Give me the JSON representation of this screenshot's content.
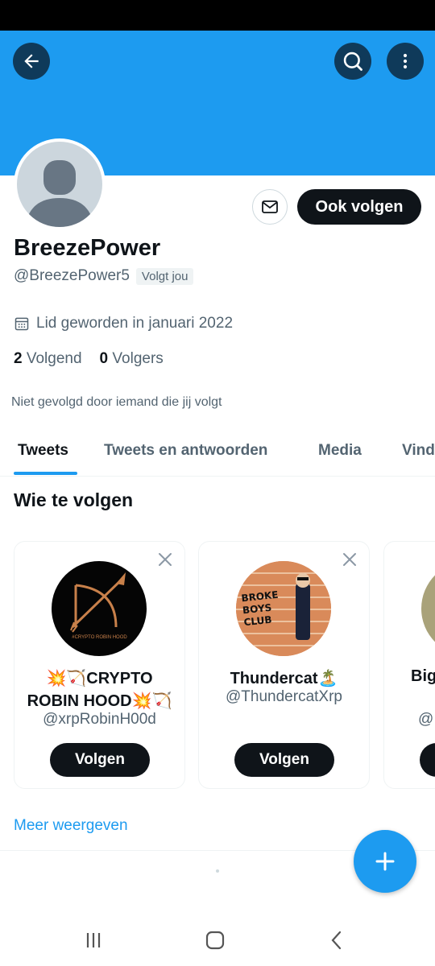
{
  "colors": {
    "accent": "#1d9bf0",
    "text_primary": "#0f1419",
    "text_secondary": "#536471",
    "border": "#eff3f4"
  },
  "header": {
    "back_icon": "arrow-left-icon",
    "search_icon": "search-icon",
    "more_icon": "more-vertical-icon"
  },
  "profile": {
    "display_name": "BreezePower",
    "handle": "@BreezePower5",
    "follows_you": "Volgt jou",
    "joined": "Lid geworden in januari 2022",
    "following_count": "2",
    "following_label": "Volgend",
    "followers_count": "0",
    "followers_label": "Volgers",
    "not_followed_text": "Niet gevolgd door iemand die jij volgt",
    "follow_back_label": "Ook volgen",
    "message_icon": "mail-icon"
  },
  "tabs": [
    {
      "label": "Tweets",
      "active": true
    },
    {
      "label": "Tweets en antwoorden",
      "active": false
    },
    {
      "label": "Media",
      "active": false
    },
    {
      "label": "Vind",
      "active": false
    }
  ],
  "who_to_follow": {
    "title": "Wie te volgen",
    "cards": [
      {
        "name": "💥🏹CRYPTO ROBIN HOOD💥🏹",
        "handle": "@xrpRobinH00d",
        "button": "Volgen",
        "avatar_text": "#CRYPTO ROBIN HOOD"
      },
      {
        "name": "Thundercat🏝️",
        "handle": "@ThundercatXrp",
        "button": "Volgen",
        "avatar_text": "BROKE BOYS CLUB"
      },
      {
        "name": "Big",
        "handle": "@",
        "button": ""
      }
    ],
    "show_more": "Meer weergeven"
  },
  "fab_icon": "plus-icon",
  "system_nav": {
    "recents_icon": "recents-icon",
    "home_icon": "home-icon",
    "back_icon": "back-chevron-icon"
  }
}
